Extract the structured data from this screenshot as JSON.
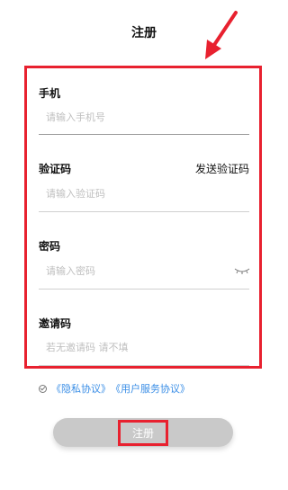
{
  "header": {
    "title": "注册"
  },
  "form": {
    "phone": {
      "label": "手机",
      "placeholder": "请输入手机号"
    },
    "code": {
      "label": "验证码",
      "placeholder": "请输入验证码",
      "send_label": "发送验证码"
    },
    "password": {
      "label": "密码",
      "placeholder": "请输入密码"
    },
    "invite": {
      "label": "邀请码",
      "placeholder": "若无邀请码 请不填"
    }
  },
  "agreement": {
    "privacy": "《隐私协议》",
    "service": "《用户服务协议》"
  },
  "submit": {
    "label": "注册"
  },
  "colors": {
    "highlight": "#e8212f",
    "link": "#3a8ee6",
    "button": "#c9c9c9"
  }
}
